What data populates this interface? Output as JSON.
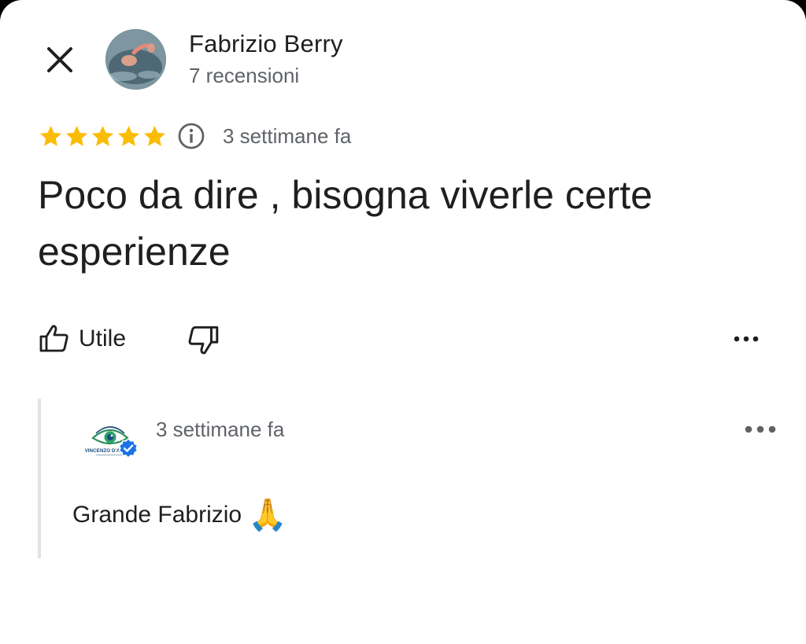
{
  "header": {
    "reviewer_name": "Fabrizio Berry",
    "review_count": "7 recensioni"
  },
  "review": {
    "rating": 5,
    "rating_max": 5,
    "date": "3 settimane fa",
    "text": "Poco da dire , bisogna viverle certe esperienze"
  },
  "actions": {
    "helpful_label": "Utile"
  },
  "owner_reply": {
    "logo_text": "VINCENZO D'AMATO",
    "date": "3 settimane fa",
    "text": "Grande Fabrizio",
    "emoji": "🙏"
  },
  "colors": {
    "star": "#fbbc04",
    "text_primary": "#1f1f1f",
    "text_secondary": "#5f6368",
    "verified": "#1a73e8",
    "reply_bar": "#e3e3e3"
  },
  "icons": {
    "close": "close-icon",
    "info": "info-icon",
    "thumbs_up": "thumbs-up-icon",
    "thumbs_down": "thumbs-down-icon",
    "more": "more-horizontal-icon",
    "verified": "verified-badge-icon"
  }
}
